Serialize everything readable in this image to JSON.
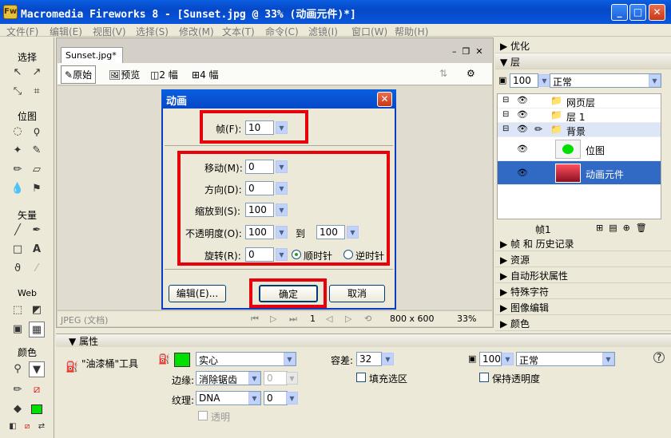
{
  "window": {
    "title": "Macromedia Fireworks 8 - [Sunset.jpg @  33% (动画元件)*]",
    "app_icon": "Fw"
  },
  "menu": [
    "文件(F)",
    "编辑(E)",
    "视图(V)",
    "选择(S)",
    "修改(M)",
    "文本(T)",
    "命令(C)",
    "滤镜(I)",
    "窗口(W)",
    "帮助(H)"
  ],
  "tools": {
    "select": "选择",
    "bitmap": "位图",
    "vector": "矢量",
    "web": "Web",
    "colors": "颜色"
  },
  "doc": {
    "tab": "Sunset.jpg*",
    "view_original": "原始",
    "view_preview": "预览",
    "view_2up": "2 幅",
    "view_4up": "4 幅"
  },
  "status": {
    "format": "JPEG (文档)",
    "frame": "1",
    "size": "800 x 600",
    "zoom": "33%"
  },
  "panels": {
    "optimize": "优化",
    "layers": "层",
    "frames": "帧 和 历史记录",
    "assets": "资源",
    "autoshape": "自动形状属性",
    "special_chars": "特殊字符",
    "image_edit": "图像编辑",
    "color": "颜色"
  },
  "layers": {
    "opacity": "100",
    "blend": "正常",
    "rows": [
      {
        "label": "网页层"
      },
      {
        "label": "层 1"
      },
      {
        "label": "背景"
      },
      {
        "label": "位图"
      },
      {
        "label": "动画元件"
      }
    ],
    "frame_label": "帧1"
  },
  "dialog": {
    "title": "动画",
    "frames_label": "帧(F):",
    "frames_value": "10",
    "move_label": "移动(M):",
    "move_value": "0",
    "direction_label": "方向(D):",
    "direction_value": "0",
    "scale_label": "缩放到(S):",
    "scale_value": "100",
    "opacity_label": "不透明度(O):",
    "opacity_from": "100",
    "opacity_to_label": "到",
    "opacity_to": "100",
    "rotate_label": "旋转(R):",
    "rotate_value": "0",
    "cw_label": "顺时针",
    "ccw_label": "逆时针",
    "edit_btn": "编辑(E)...",
    "ok_btn": "确定",
    "cancel_btn": "取消"
  },
  "props": {
    "header": "属性",
    "tool_name": "\"油漆桶\"工具",
    "fill_type": "实心",
    "edge_label": "边缘:",
    "edge_value": "消除锯齿",
    "edge_amount": "0",
    "texture_label": "纹理:",
    "texture_value": "DNA",
    "texture_amount": "0",
    "transparent_label": "透明",
    "tolerance_label": "容差:",
    "tolerance_value": "32",
    "fill_selection_label": "填充选区",
    "opacity_value": "100",
    "blend_value": "正常",
    "preserve_transparency_label": "保持透明度",
    "help": "?"
  },
  "colors": {
    "fill": "#00e000",
    "accent": "#e8000a",
    "thumb": "#c8203a"
  }
}
